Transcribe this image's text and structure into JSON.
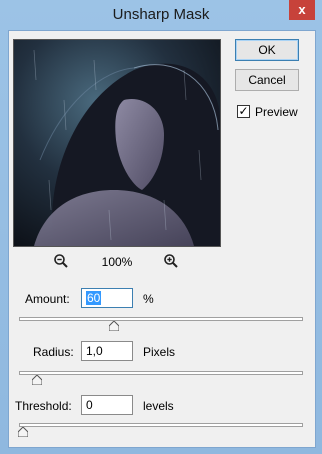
{
  "window": {
    "title": "Unsharp Mask",
    "close_glyph": "x"
  },
  "buttons": {
    "ok": "OK",
    "cancel": "Cancel"
  },
  "preview": {
    "label": "Preview",
    "checked": true,
    "check_glyph": "✓"
  },
  "zoom": {
    "level": "100%",
    "out_icon": "zoom-out-icon",
    "in_icon": "zoom-in-icon"
  },
  "controls": {
    "amount": {
      "label": "Amount:",
      "value": "60",
      "unit": "%",
      "slider_fraction": 0.32
    },
    "radius": {
      "label": "Radius:",
      "value": "1,0",
      "unit": "Pixels",
      "slider_fraction": 0.05
    },
    "threshold": {
      "label": "Threshold:",
      "value": "0",
      "unit": "levels",
      "slider_fraction": 0.0
    }
  },
  "colors": {
    "title_bar": "#9cc3e6",
    "close_button": "#c7423a",
    "selection": "#3399ff"
  }
}
